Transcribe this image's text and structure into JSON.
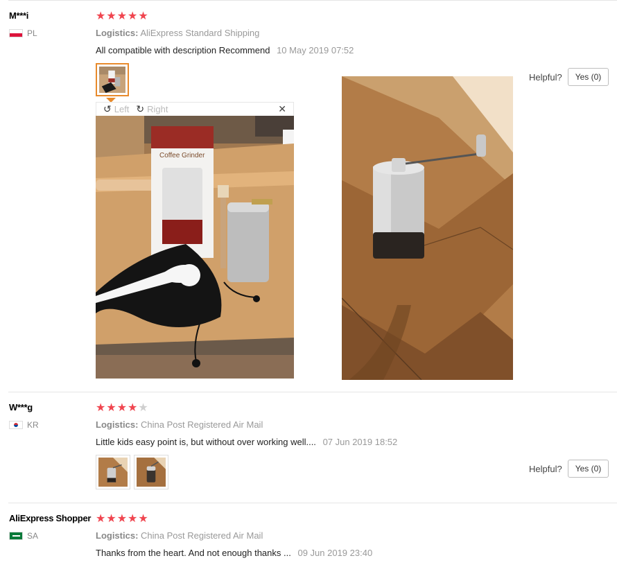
{
  "reviews": [
    {
      "user": "M***i",
      "country": "PL",
      "rating": 5,
      "logistics_label": "Logistics:",
      "logistics": "AliExpress Standard Shipping",
      "comment": "All compatible with description Recommend",
      "date": "10 May 2019 07:52",
      "helpful_label": "Helpful?",
      "yes_label": "Yes (0)"
    },
    {
      "user": "W***g",
      "country": "KR",
      "rating": 4,
      "logistics_label": "Logistics:",
      "logistics": "China Post Registered Air Mail",
      "comment": "Little kids easy point is, but without over working well....",
      "date": "07 Jun 2019 18:52",
      "helpful_label": "Helpful?",
      "yes_label": "Yes (0)"
    },
    {
      "user": "AliExpress Shopper",
      "country": "SA",
      "rating": 5,
      "logistics_label": "Logistics:",
      "logistics": "China Post Registered Air Mail",
      "comment": "Thanks from the heart. And not enough thanks ...",
      "date": "09 Jun 2019 23:40"
    }
  ],
  "viewer": {
    "left_label": "Left",
    "right_label": "Right",
    "close_icon": "close-icon",
    "rotate_left_icon": "rotate-left-icon",
    "rotate_right_icon": "rotate-right-icon",
    "box_text": "Coffee Grinder"
  },
  "colors": {
    "star_on": "#f0454f",
    "star_off": "#cfcfcf",
    "thumb_active": "#e88a2b"
  }
}
